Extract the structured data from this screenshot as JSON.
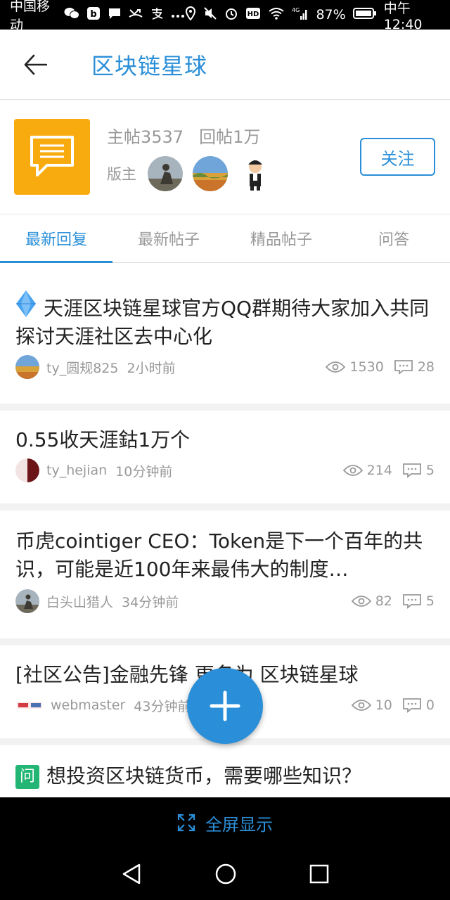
{
  "status_bar": {
    "carrier": "中国移动",
    "battery": "87%",
    "time": "中午12:40",
    "network": "4G"
  },
  "header": {
    "title": "区块链星球"
  },
  "forum": {
    "main_posts": "主帖3537",
    "replies": "回帖1万",
    "moderator_label": "版主",
    "follow_label": "关注"
  },
  "tabs": [
    {
      "label": "最新回复",
      "active": true
    },
    {
      "label": "最新帖子",
      "active": false
    },
    {
      "label": "精品帖子",
      "active": false
    },
    {
      "label": "问答",
      "active": false
    }
  ],
  "posts": [
    {
      "title": "天涯区块链星球官方QQ群期待大家加入共同探讨天涯社区去中心化",
      "author": "ty_圆规825",
      "time": "2小时前",
      "views": "1530",
      "comments": "28"
    },
    {
      "title": "0.55收天涯鈷1万个",
      "author": "ty_hejian",
      "time": "10分钟前",
      "views": "214",
      "comments": "5"
    },
    {
      "title": "币虎cointiger CEO：Token是下一个百年的共识，可能是近100年来最伟大的制度…",
      "author": "白头山猎人",
      "time": "34分钟前",
      "views": "82",
      "comments": "5"
    },
    {
      "title": "[社区公告]金融先锋 更名为 区块链星球",
      "author": "webmaster",
      "time": "43分钟前",
      "views": "10",
      "comments": "0"
    },
    {
      "badge": "问",
      "title": "想投资区块链货币，需要哪些知识？"
    }
  ],
  "fullscreen": {
    "label": "全屏显示"
  },
  "colors": {
    "accent": "#2a8fd8",
    "logo_bg": "#f8ab0f",
    "qa_badge": "#22b573"
  }
}
